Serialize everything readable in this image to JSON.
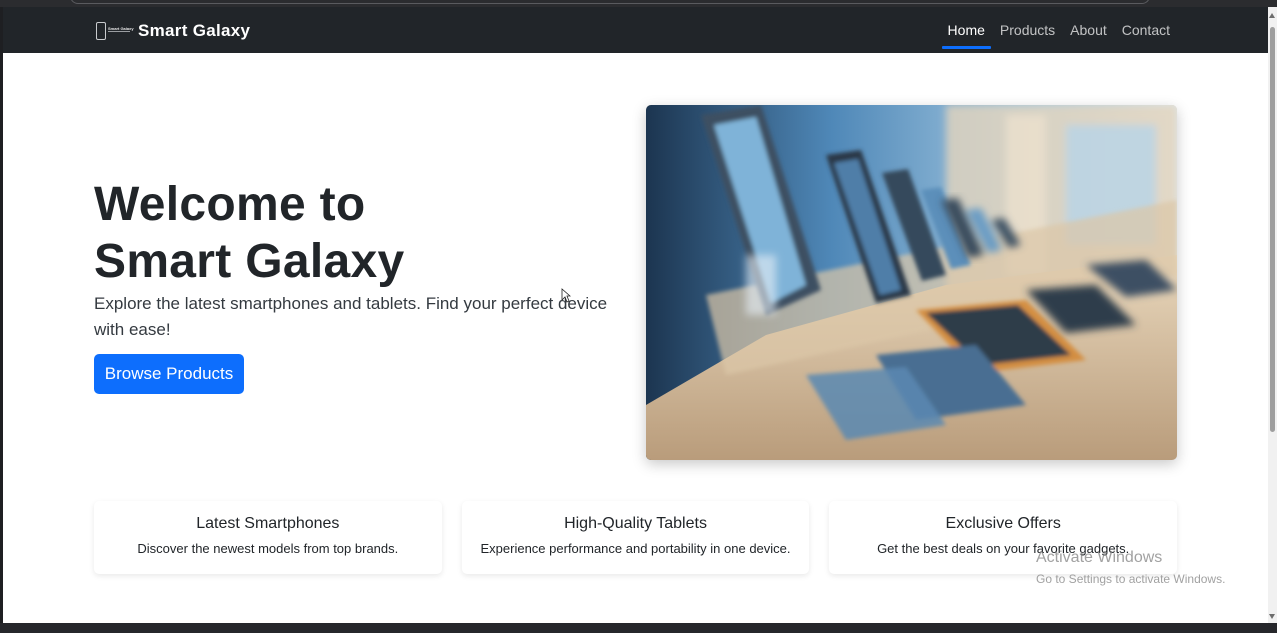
{
  "navbar": {
    "brand_logo_text": "Smart Galaxy",
    "brand_name": "Smart Galaxy",
    "links": [
      "Home",
      "Products",
      "About",
      "Contact"
    ],
    "active_link": "Home"
  },
  "hero": {
    "title_line1": "Welcome to",
    "title_line2": "Smart Galaxy",
    "subtitle": "Explore the latest smartphones and tablets. Find your perfect device with ease!",
    "button_label": "Browse Products",
    "image_alt": "smartphones on display stands in a store"
  },
  "features": [
    {
      "title": "Latest Smartphones",
      "text": "Discover the newest models from top brands."
    },
    {
      "title": "High-Quality Tablets",
      "text": "Experience performance and portability in one device."
    },
    {
      "title": "Exclusive Offers",
      "text": "Get the best deals on your favorite gadgets."
    }
  ],
  "watermark": {
    "title": "Activate Windows",
    "subtitle": "Go to Settings to activate Windows."
  },
  "colors": {
    "navbar_bg": "#212529",
    "accent": "#0d6efd",
    "text": "#212529"
  }
}
